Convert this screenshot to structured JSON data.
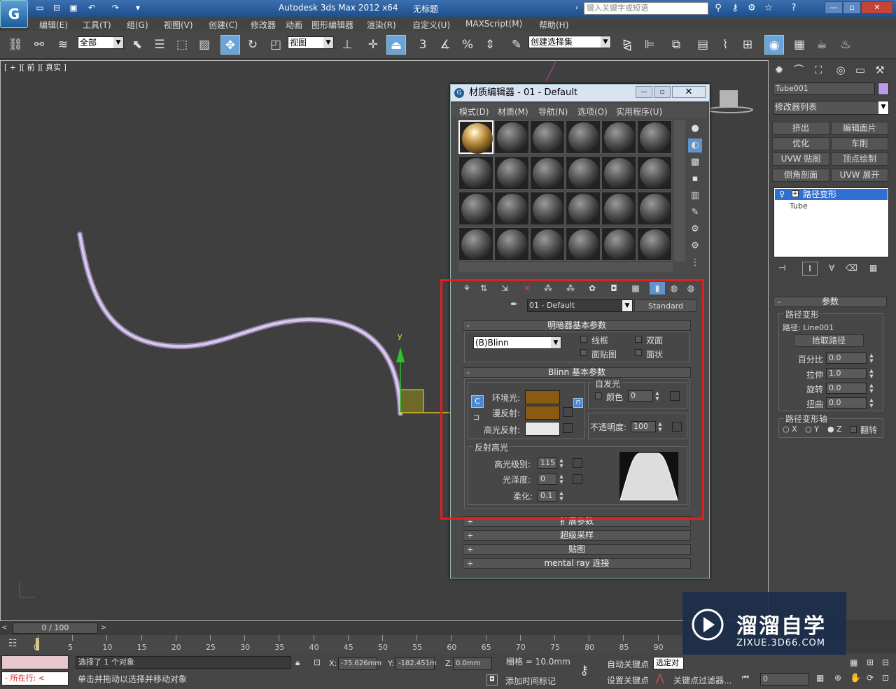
{
  "app": {
    "title": "Autodesk 3ds Max  2012 x64",
    "doc": "无标题",
    "search_placeholder": "键入关键字或短语"
  },
  "menus": [
    "编辑(E)",
    "工具(T)",
    "组(G)",
    "视图(V)",
    "创建(C)",
    "修改器",
    "动画",
    "图形编辑器",
    "渲染(R)",
    "自定义(U)",
    "MAXScript(M)",
    "帮助(H)"
  ],
  "toolbar": {
    "filter": "全部",
    "ref_coord": "视图",
    "named_sel": "创建选择集"
  },
  "viewport": {
    "label": "[ + ][ 前 ][ 真实 ]",
    "axis_y": "y"
  },
  "command_panel": {
    "object_name": "Tube001",
    "modifier_list": "修改器列表",
    "mod_buttons": [
      "挤出",
      "编辑面片",
      "优化",
      "车削",
      "UVW 贴图",
      "顶点绘制",
      "倒角剖面",
      "UVW 展开"
    ],
    "stack": [
      "路径变形",
      "Tube"
    ],
    "params": {
      "title": "参数",
      "group": "路径变形",
      "path_label": "路径: Line001",
      "pick": "拾取路径",
      "fields": [
        {
          "label": "百分比",
          "value": "0.0"
        },
        {
          "label": "拉伸",
          "value": "1.0"
        },
        {
          "label": "旋转",
          "value": "0.0"
        },
        {
          "label": "扭曲",
          "value": "0.0"
        }
      ],
      "axis_group": "路径变形轴",
      "axes": [
        "X",
        "Y",
        "Z"
      ],
      "flip": "翻转"
    }
  },
  "material_editor": {
    "title": "材质编辑器 - 01 - Default",
    "menus": [
      "模式(D)",
      "材质(M)",
      "导航(N)",
      "选项(O)",
      "实用程序(U)"
    ],
    "mat_name": "01 - Default",
    "mat_type": "Standard",
    "shader": {
      "title": "明暗器基本参数",
      "type": "(B)Blinn",
      "opts": [
        "线框",
        "双面",
        "面贴图",
        "面状"
      ]
    },
    "blinn": {
      "title": "Blinn 基本参数",
      "ambient": "环境光:",
      "diffuse": "漫反射:",
      "specular": "高光反射:",
      "self_illum": "自发光",
      "color": "颜色",
      "self_val": "0",
      "opacity_label": "不透明度:",
      "opacity": "100",
      "spec_title": "反射高光",
      "spec_level_label": "高光级别:",
      "spec_level": "115",
      "gloss_label": "光泽度:",
      "gloss": "0",
      "soften_label": "柔化:",
      "soften": "0.1"
    },
    "rollouts": [
      "扩展参数",
      "超级采样",
      "贴图",
      "mental ray 连接"
    ],
    "colors": {
      "ambient": "#8a5a10",
      "diffuse": "#8a5a10",
      "specular": "#e8e8e8"
    }
  },
  "timeline": {
    "frame": "0 / 100",
    "ticks": [
      "0",
      "5",
      "10",
      "15",
      "20",
      "25",
      "30",
      "35",
      "40",
      "45",
      "50",
      "55",
      "60",
      "65",
      "70",
      "75",
      "80",
      "85",
      "90"
    ]
  },
  "status": {
    "selected": "选择了 1 个对象",
    "prompt": "单击并拖动以选择并移动对象",
    "x_label": "X:",
    "x": "-75.626mm",
    "y_label": "Y:",
    "y": "-182.451m",
    "z_label": "Z:",
    "z": "0.0mm",
    "grid": "栅格 = 10.0mm",
    "auto_key": "自动关键点",
    "set_key": "设置关键点",
    "sel_set": "选定对",
    "key_filter": "关键点过滤器...",
    "add_tag": "添加时间标记",
    "frame_field": "0",
    "running": "所在行:"
  },
  "watermark": {
    "name": "溜溜自学",
    "url": "ZIXUE.3D66.COM"
  }
}
